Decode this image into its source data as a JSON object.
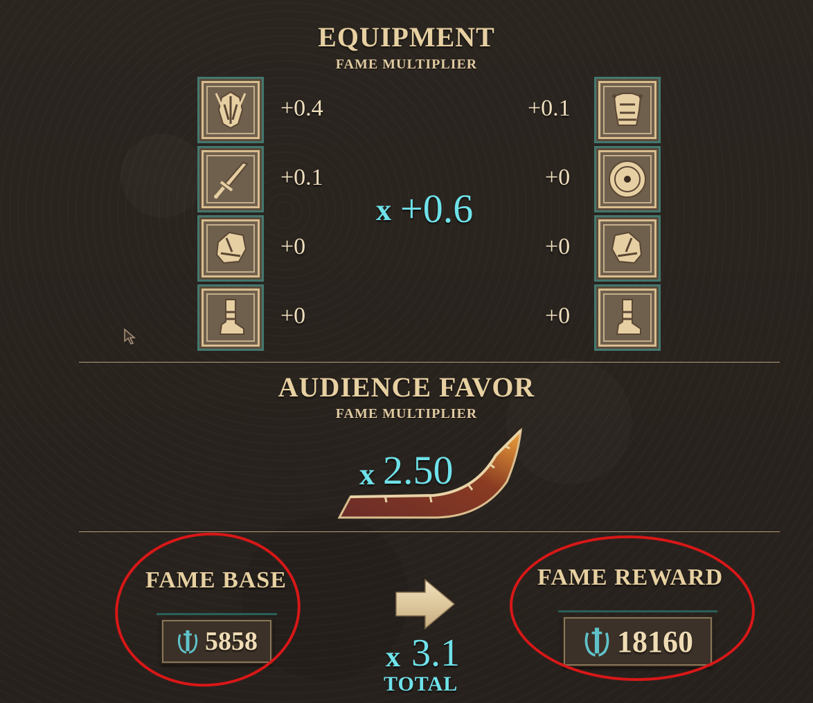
{
  "equipment": {
    "title": "EQUIPMENT",
    "subtitle": "FAME MULTIPLIER",
    "left_slots": [
      {
        "icon": "helmet-icon",
        "value": "+0.4"
      },
      {
        "icon": "sword-icon",
        "value": "+0.1"
      },
      {
        "icon": "gauntlet-icon",
        "value": "+0"
      },
      {
        "icon": "boot-icon",
        "value": "+0"
      }
    ],
    "right_slots": [
      {
        "icon": "chest-armor-icon",
        "value": "+0.1"
      },
      {
        "icon": "shield-icon",
        "value": "+0"
      },
      {
        "icon": "gauntlet-icon",
        "value": "+0"
      },
      {
        "icon": "boot-icon",
        "value": "+0"
      }
    ],
    "total_prefix": "x",
    "total": "+0.6"
  },
  "audience": {
    "title": "AUDIENCE FAVOR",
    "subtitle": "FAME MULTIPLIER",
    "prefix": "x",
    "value": "2.50"
  },
  "fame_base": {
    "label": "FAME BASE",
    "value": "5858",
    "icon": "laurel-sword-icon"
  },
  "fame_reward": {
    "label": "FAME REWARD",
    "value": "18160",
    "icon": "laurel-sword-icon"
  },
  "total": {
    "prefix": "x",
    "value": "3.1",
    "label": "TOTAL"
  },
  "colors": {
    "accent_cyan": "#6fe2ea",
    "gold_text": "#e7d0a1",
    "annotation_red": "#d81717"
  }
}
